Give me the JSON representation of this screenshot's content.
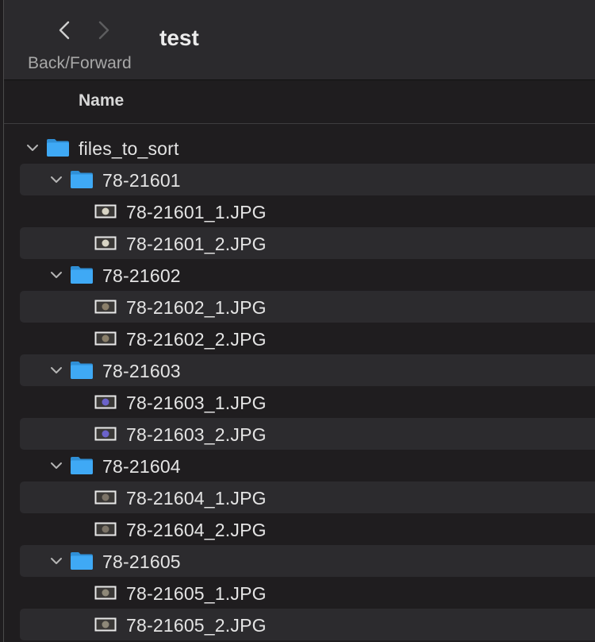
{
  "toolbar": {
    "title": "test",
    "nav_caption": "Back/Forward",
    "back_icon": "chevron-left-icon",
    "forward_icon": "chevron-right-icon"
  },
  "columns": {
    "name": "Name"
  },
  "colors": {
    "folder": "#3fa9f5",
    "window_bg": "#1f1d1f",
    "toolbar_bg": "#2b2a2d",
    "stripe": "#2c2b2e"
  },
  "tree": {
    "root": {
      "label": "files_to_sort",
      "expanded": true
    },
    "folders": [
      {
        "label": "78-21601",
        "expanded": true,
        "files": [
          "78-21601_1.JPG",
          "78-21601_2.JPG"
        ],
        "thumb": "#d8d4c4"
      },
      {
        "label": "78-21602",
        "expanded": true,
        "files": [
          "78-21602_1.JPG",
          "78-21602_2.JPG"
        ],
        "thumb": "#8a7f6a"
      },
      {
        "label": "78-21603",
        "expanded": true,
        "files": [
          "78-21603_1.JPG",
          "78-21603_2.JPG"
        ],
        "thumb": "#6b62c9"
      },
      {
        "label": "78-21604",
        "expanded": true,
        "files": [
          "78-21604_1.JPG",
          "78-21604_2.JPG"
        ],
        "thumb": "#7c7468"
      },
      {
        "label": "78-21605",
        "expanded": true,
        "files": [
          "78-21605_1.JPG",
          "78-21605_2.JPG"
        ],
        "thumb": "#8e8878"
      }
    ]
  }
}
